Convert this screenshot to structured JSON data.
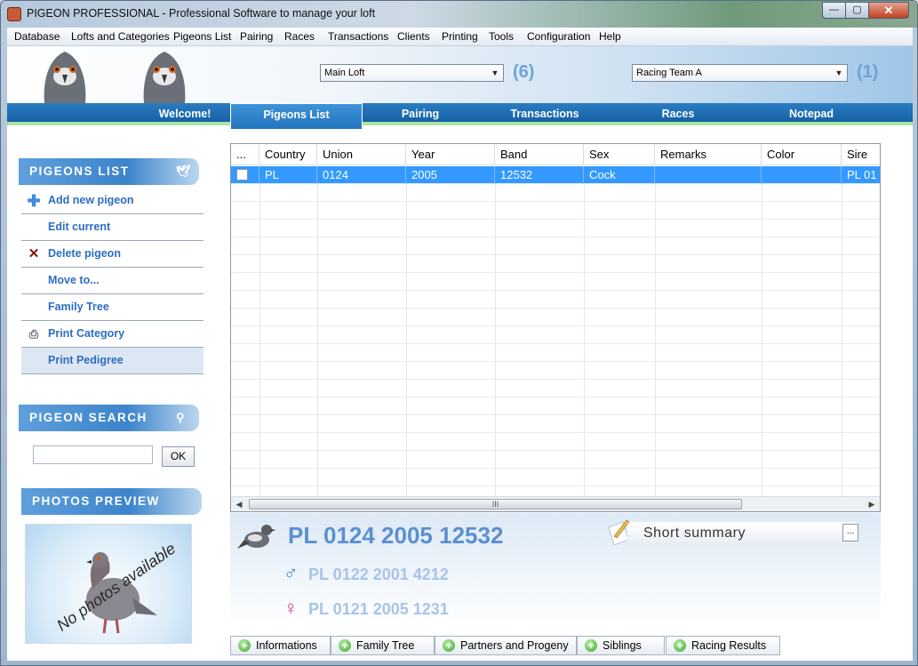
{
  "window": {
    "title": "PIGEON PROFESSIONAL - Professional Software to manage your loft",
    "min_label": "—",
    "max_label": "▢",
    "close_label": "✕"
  },
  "menu": [
    "Database",
    "Lofts and Categories",
    "Pigeons List",
    "Pairing",
    "Races",
    "Transactions",
    "Clients",
    "Printing",
    "Tools",
    "Configuration",
    "Help"
  ],
  "header": {
    "loft_value": "Main Loft",
    "loft_count": "(6)",
    "team_value": "Racing Team A",
    "team_count": "(1)"
  },
  "nav_tabs": [
    "Welcome!",
    "Pigeons List",
    "Pairing",
    "Transactions",
    "Races",
    "Notepad"
  ],
  "active_nav_tab": "Pigeons List",
  "sidebar": {
    "list_title": "PIGEONS LIST",
    "list_items": [
      {
        "label": "Add new pigeon",
        "icon": "plus-icon"
      },
      {
        "label": "Edit current",
        "icon": ""
      },
      {
        "label": "Delete pigeon",
        "icon": "delete-icon"
      },
      {
        "label": "Move to...",
        "icon": ""
      },
      {
        "label": "Family Tree",
        "icon": ""
      },
      {
        "label": "Print Category",
        "icon": "printer-icon"
      },
      {
        "label": "Print Pedigree",
        "icon": ""
      }
    ],
    "search_title": "PIGEON SEARCH",
    "search_value": "",
    "ok_label": "OK",
    "photos_title": "PHOTOS PREVIEW",
    "photo_placeholder": "No photos available"
  },
  "grid": {
    "columns": [
      "...",
      "Country",
      "Union",
      "Year",
      "Band",
      "Sex",
      "Remarks",
      "Color",
      "Sire"
    ],
    "rows": [
      {
        "country": "PL",
        "union": "0124",
        "year": "2005",
        "band": "12532",
        "sex": "Cock",
        "remarks": "",
        "color": "",
        "sire": "PL 01"
      }
    ],
    "scroll_grip": "III"
  },
  "detail": {
    "main_id": "PL 0124 2005 12532",
    "sire_id": "PL 0122 2001 4212",
    "dam_id": "PL 0121 2005 1231",
    "summary_label": "Short summary",
    "summary_button": "...",
    "male_symbol": "♂",
    "female_symbol": "♀"
  },
  "bottom_tabs": [
    "Informations",
    "Family Tree",
    "Partners and Progeny",
    "Siblings",
    "Racing Results"
  ]
}
